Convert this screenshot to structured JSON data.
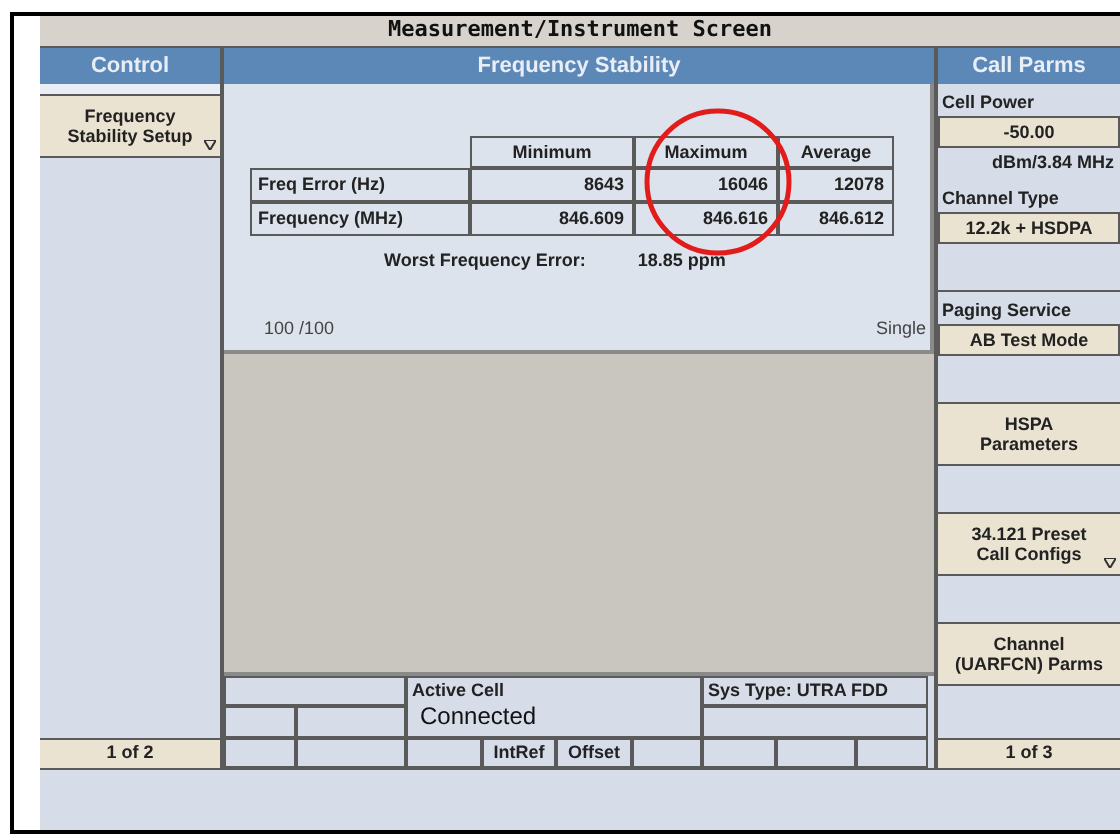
{
  "title": "Measurement/Instrument Screen",
  "control": {
    "header": "Control",
    "buttons": [
      {
        "label": "Frequency Stability Setup",
        "submenu": true
      }
    ],
    "page": "1 of 2"
  },
  "measurement": {
    "header": "Frequency Stability",
    "columns": [
      "Minimum",
      "Maximum",
      "Average"
    ],
    "rows": [
      {
        "label": "Freq Error (Hz)",
        "values": [
          "8643",
          "16046",
          "12078"
        ]
      },
      {
        "label": "Frequency (MHz)",
        "values": [
          "846.609",
          "846.616",
          "846.612"
        ]
      }
    ],
    "worst_label": "Worst Frequency Error:",
    "worst_value": "18.85 ppm",
    "count": "100 /100",
    "mode": "Single"
  },
  "call_parms": {
    "header": "Call Parms",
    "items": [
      {
        "kind": "label",
        "text": "Cell Power"
      },
      {
        "kind": "value",
        "text": "-50.00"
      },
      {
        "kind": "unit",
        "text": "dBm/3.84 MHz"
      },
      {
        "kind": "label",
        "text": "Channel Type"
      },
      {
        "kind": "value",
        "text": "12.2k + HSDPA"
      },
      {
        "kind": "gap"
      },
      {
        "kind": "label",
        "text": "Paging Service"
      },
      {
        "kind": "value",
        "text": "AB Test Mode"
      },
      {
        "kind": "gap"
      },
      {
        "kind": "button",
        "text": "HSPA Parameters",
        "submenu": false
      },
      {
        "kind": "gap"
      },
      {
        "kind": "button",
        "text": "34.121 Preset Call Configs",
        "submenu": true
      },
      {
        "kind": "gap"
      },
      {
        "kind": "button",
        "text": "Channel (UARFCN) Parms",
        "submenu": false
      }
    ],
    "page": "1 of 3"
  },
  "status": {
    "active_cell_label": "Active Cell",
    "active_cell_state": "Connected",
    "sys_type": "Sys Type: UTRA FDD",
    "keys": [
      "IntRef",
      "Offset"
    ]
  }
}
